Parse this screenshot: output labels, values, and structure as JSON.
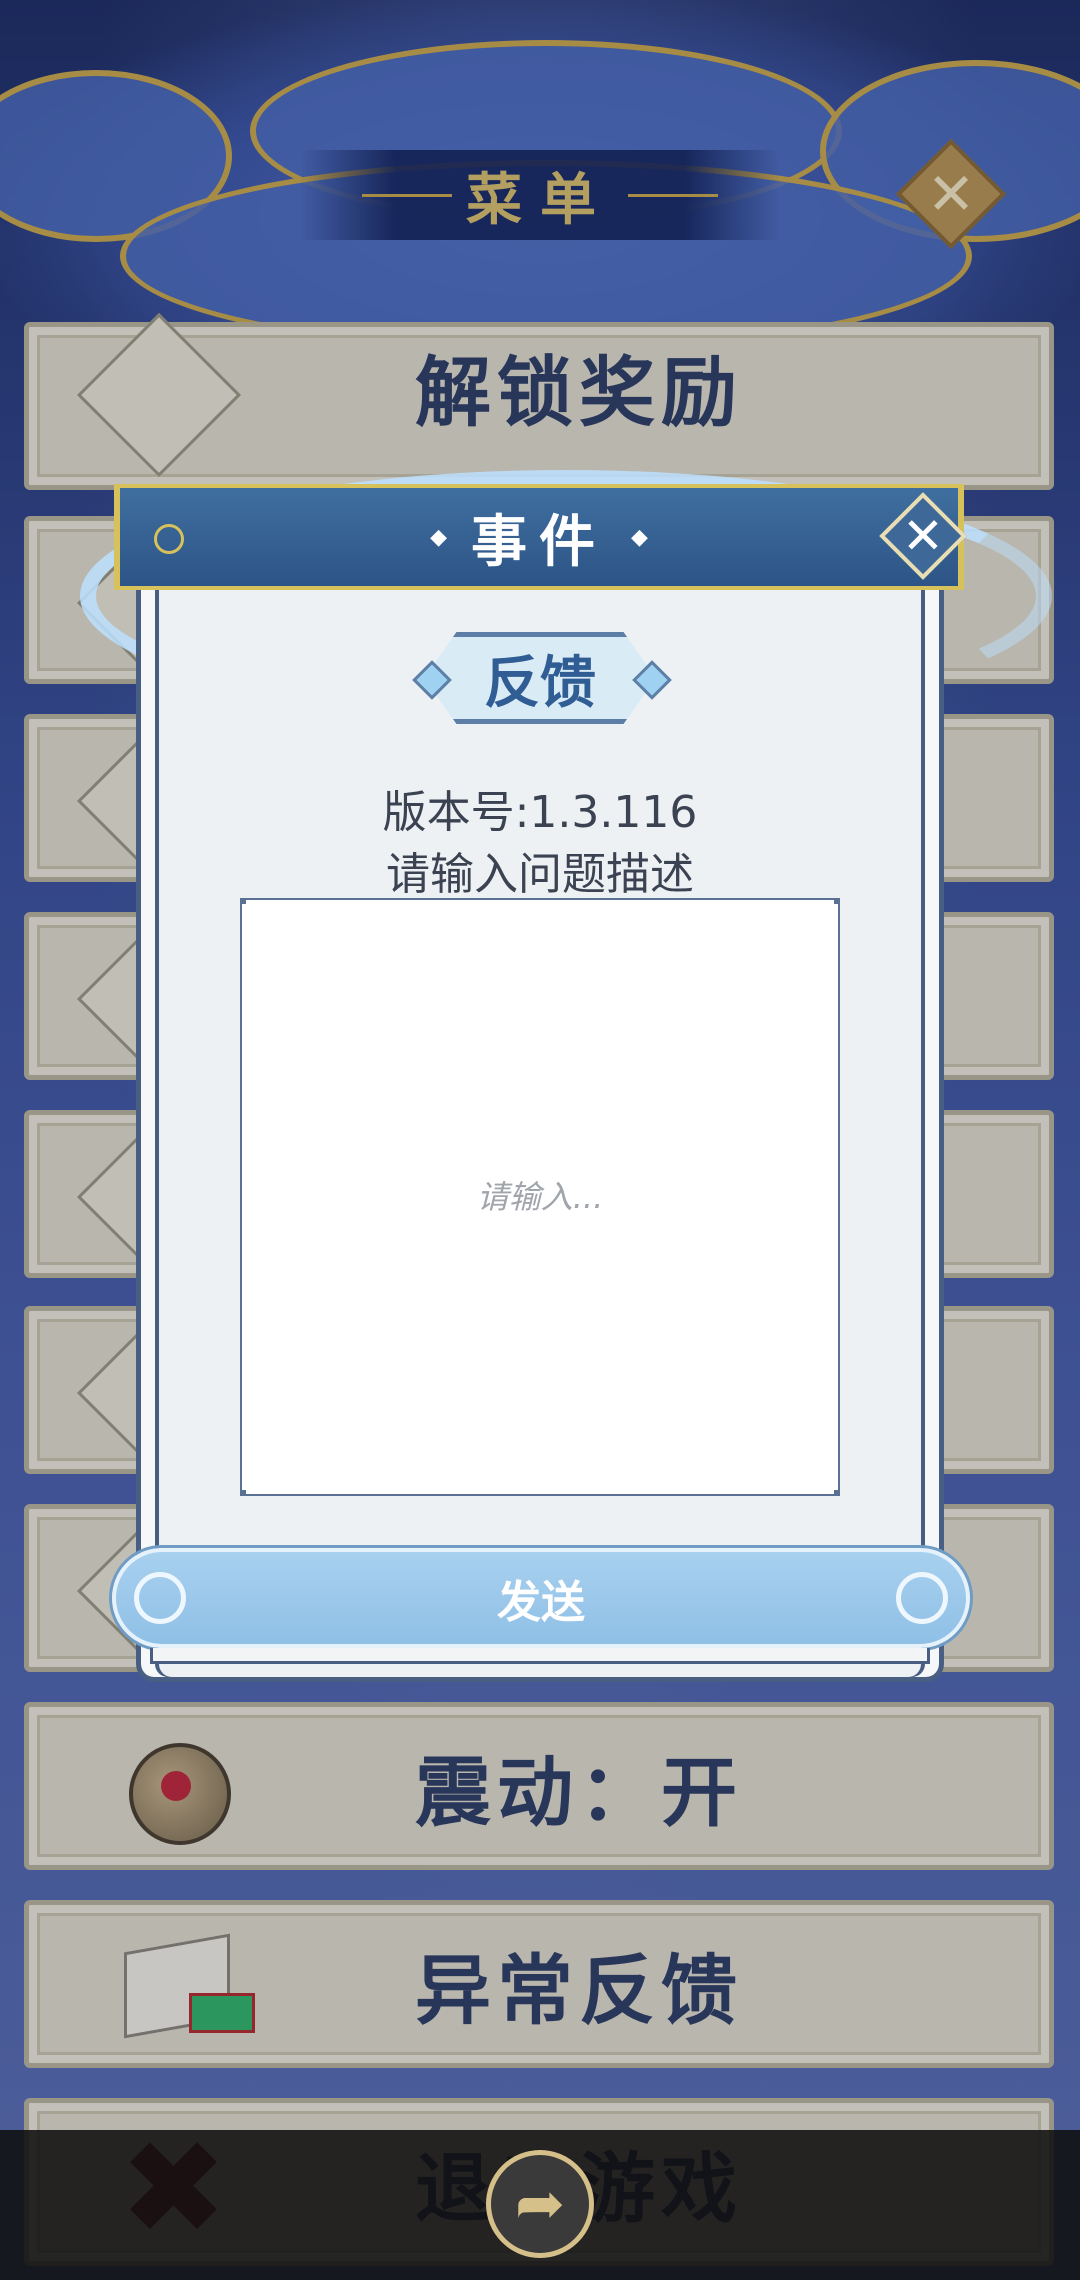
{
  "menu": {
    "title": "菜单",
    "close_icon": "close-icon",
    "items": [
      {
        "label": "解锁奖励",
        "icon": "reward-icon"
      },
      {
        "label": "",
        "icon": "bamboo-icon"
      },
      {
        "label": "",
        "icon": "stone-icon"
      },
      {
        "label": "",
        "icon": "bow-icon"
      },
      {
        "label": "",
        "icon": "shrine-icon"
      },
      {
        "label": "",
        "icon": "cloud-icon"
      },
      {
        "label": "",
        "icon": "brush-icon"
      },
      {
        "label": "震动：开",
        "icon": "gong-icon"
      },
      {
        "label": "异常反馈",
        "icon": "scroll-icon"
      },
      {
        "label": "退出游戏",
        "icon": "red-x-icon"
      }
    ]
  },
  "dialog": {
    "title": "事件",
    "section_title": "反馈",
    "version": "版本号:1.3.116",
    "prompt": "请输入问题描述",
    "input": {
      "placeholder": "请输入...",
      "value": ""
    },
    "send_label": "发送"
  },
  "bottom_bar": {
    "share_icon": "share-icon"
  },
  "colors": {
    "header_blue": "#2d5486",
    "gold": "#d7c15a",
    "send_button": "#8fc0e6",
    "menu_text": "#2f3d63"
  }
}
